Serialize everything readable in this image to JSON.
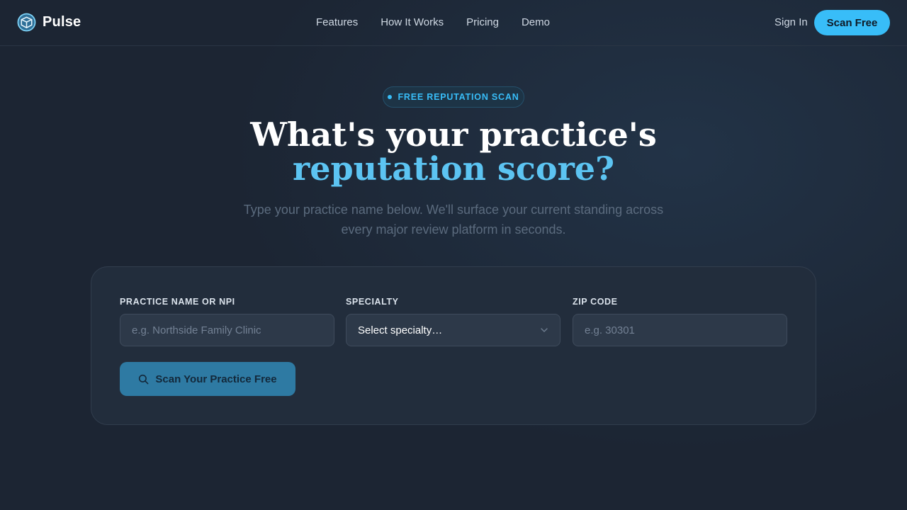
{
  "brand": {
    "name": "Pulse",
    "logo_icon": "shield-logo-icon",
    "accent": "#38bdf8"
  },
  "nav": {
    "links": [
      "Features",
      "How It Works",
      "Pricing",
      "Demo"
    ],
    "sign_in": "Sign In",
    "cta": "Scan Free"
  },
  "hero": {
    "badge": "FREE REPUTATION SCAN",
    "headline_line1": "What's your practice's",
    "headline_line2": "reputation score?",
    "subtitle": "Type your practice name below. We'll surface your current standing across every major review platform in seconds."
  },
  "form": {
    "practice": {
      "label": "PRACTICE NAME OR NPI",
      "placeholder": "e.g. Northside Family Clinic",
      "value": ""
    },
    "specialty": {
      "label": "SPECIALTY",
      "selected": "Select specialty…"
    },
    "zip": {
      "label": "ZIP CODE",
      "placeholder": "e.g. 30301",
      "value": ""
    },
    "submit": {
      "label": "Scan Your Practice Free",
      "icon": "search-icon"
    }
  }
}
